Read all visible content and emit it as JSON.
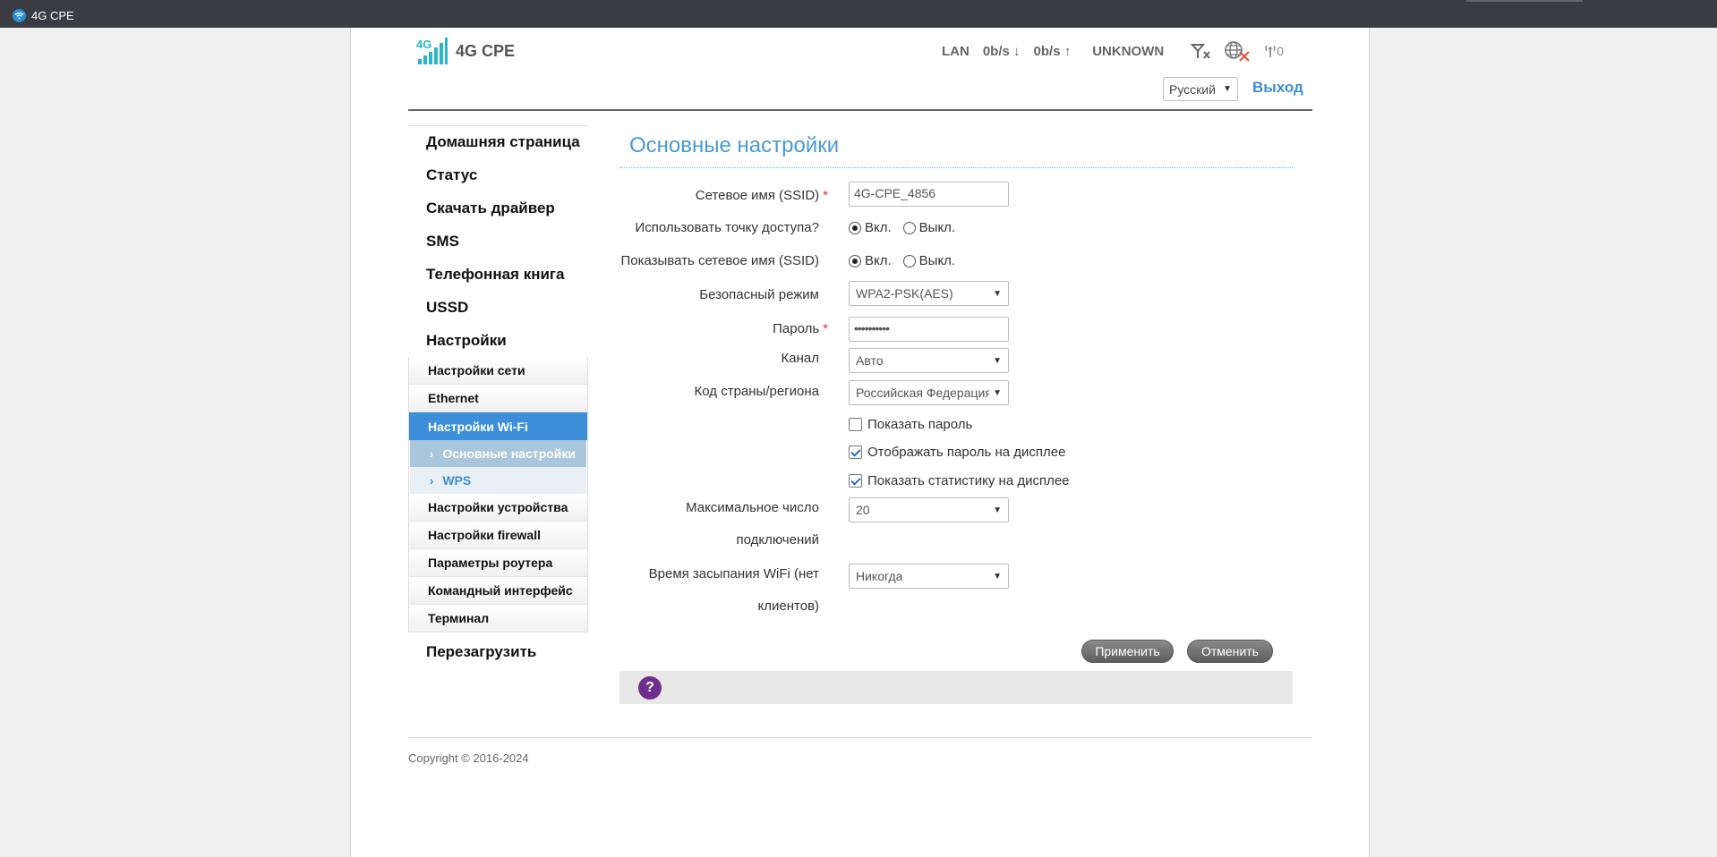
{
  "browser": {
    "tab_title": "4G CPE"
  },
  "header": {
    "brand": "4G CPE",
    "status": {
      "connection": "LAN",
      "download": "0b/s ↓",
      "upload": "0b/s ↑",
      "operator": "UNKNOWN",
      "clients": "0"
    },
    "language": "Русский",
    "logout": "Выход"
  },
  "nav": {
    "main_top": [
      "Домашняя страница",
      "Статус",
      "Скачать драйвер",
      "SMS",
      "Телефонная книга",
      "USSD",
      "Настройки"
    ],
    "settings_sub": {
      "network": "Настройки сети",
      "ethernet": "Ethernet",
      "wifi": "Настройки Wi-Fi",
      "wifi_basic": "Основные настройки",
      "wifi_wps": "WPS",
      "device": "Настройки устройства",
      "firewall": "Настройки firewall",
      "router": "Параметры роутера",
      "cli": "Командный интерфейс",
      "terminal": "Терминал"
    },
    "reboot": "Перезагрузить"
  },
  "form": {
    "title": "Основные настройки",
    "ssid_label": "Сетевое имя (SSID)",
    "ssid_value": "4G-CPE_4856",
    "ap_label": "Использовать точку доступа?",
    "broadcast_label": "Показывать сетевое имя (SSID)",
    "on_label": "Вкл.",
    "off_label": "Выкл.",
    "security_label": "Безопасный режим",
    "security_value": "WPA2-PSK(AES)",
    "password_label": "Пароль",
    "password_value": "••••••••••",
    "channel_label": "Канал",
    "channel_value": "Авто",
    "country_label": "Код страны/региона",
    "country_value": "Российская Федерация",
    "show_password": "Показать пароль",
    "display_password": "Отображать пароль на дисплее",
    "display_stats": "Показать статистику на дисплее",
    "max_clients_label_1": "Максимальное число",
    "max_clients_label_2": "подключений",
    "max_clients_value": "20",
    "sleep_label_1": "Время засыпания WiFi (нет",
    "sleep_label_2": "клиентов)",
    "sleep_value": "Никогда",
    "required_mark": "*",
    "apply": "Применить",
    "cancel": "Отменить",
    "help": "?"
  },
  "footer": {
    "copyright": "Copyright © 2016-2024"
  },
  "colors": {
    "accent": "#3c8fd8",
    "title": "#4a9ad4",
    "help": "#6e2f8c"
  }
}
